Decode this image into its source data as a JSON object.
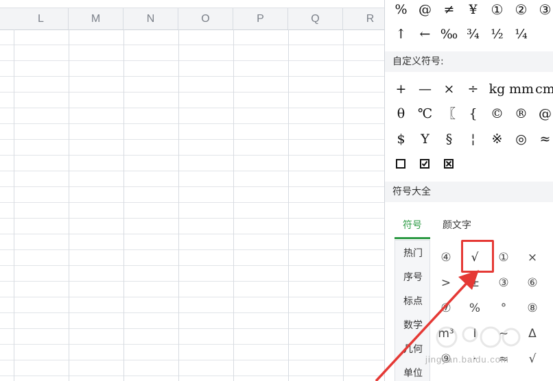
{
  "spreadsheet": {
    "columns": [
      "L",
      "M",
      "N",
      "O",
      "P",
      "Q",
      "R"
    ]
  },
  "panel": {
    "recent_row1": [
      "%",
      "@",
      "≠",
      "¥",
      "①",
      "②",
      "③"
    ],
    "recent_row2": [
      "↑",
      "←",
      "‰",
      "¾",
      "½",
      "¼"
    ],
    "custom_label": "自定义符号:",
    "custom_row1": [
      "+",
      "—",
      "×",
      "÷",
      "kg",
      "mm",
      "cm"
    ],
    "custom_row2": [
      "θ",
      "℃",
      "〖",
      "{",
      "©",
      "®",
      "@"
    ],
    "custom_row3": [
      "$",
      "Y",
      "§",
      "¦",
      "※",
      "◎",
      "≈"
    ],
    "custom_row4_icons": [
      "empty-box-icon",
      "checked-box-icon",
      "crossed-box-icon"
    ],
    "all_label": "符号大全",
    "tabs": [
      "符号",
      "颜文字"
    ],
    "active_tab": "符号",
    "categories": [
      "热门",
      "序号",
      "标点",
      "数学",
      "几何",
      "单位"
    ],
    "symbol_grid": [
      [
        "④",
        "√",
        "①",
        "×"
      ],
      [
        ">",
        "±",
        "③",
        "⑥"
      ],
      [
        "⑦",
        "%",
        "°",
        "⑧"
      ],
      [
        "m³",
        "Ⅰ",
        "~",
        "Δ"
      ],
      [
        "⑨",
        "·",
        "≈",
        "√"
      ]
    ],
    "highlighted_symbol": "√"
  },
  "watermark": {
    "text": "jingyan.baidu.com"
  },
  "colors": {
    "accent_green": "#2e9b45",
    "highlight_red": "#e53935"
  }
}
